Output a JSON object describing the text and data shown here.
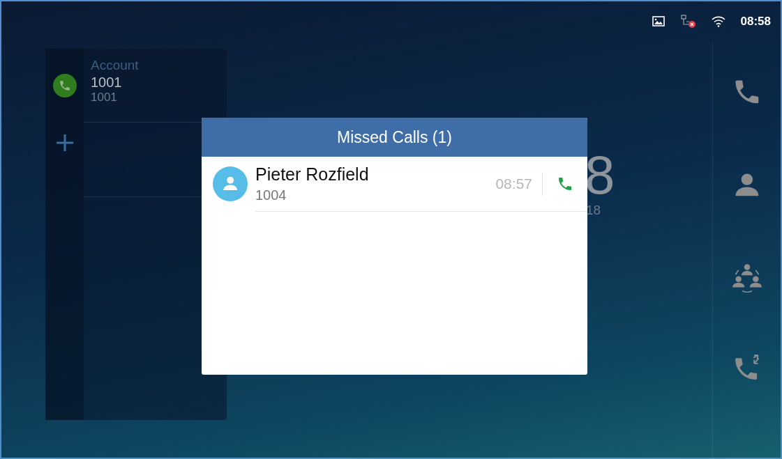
{
  "status_bar": {
    "time": "08:58"
  },
  "account_panel": {
    "label": "Account",
    "name": "1001",
    "number": "1001"
  },
  "clock": {
    "time_fragment": "8",
    "date_fragment": "18"
  },
  "dock": {
    "items": [
      {
        "kind": "phone"
      },
      {
        "kind": "contact"
      },
      {
        "kind": "conference"
      },
      {
        "kind": "transfer"
      }
    ]
  },
  "dialog": {
    "title": "Missed Calls (1)",
    "calls": [
      {
        "name": "Pieter Rozfield",
        "number": "1004",
        "time": "08:57"
      }
    ]
  }
}
